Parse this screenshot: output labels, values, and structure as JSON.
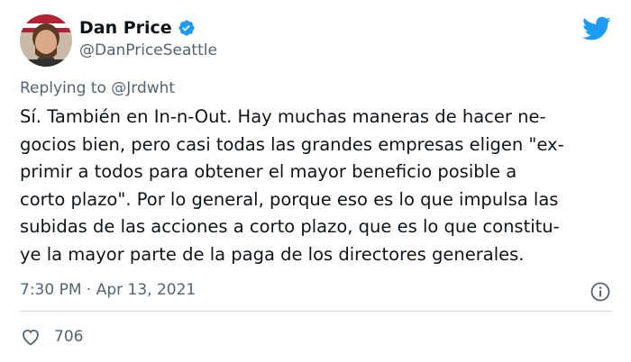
{
  "author": {
    "display_name": "Dan Price",
    "handle": "@DanPriceSeattle",
    "verified": true
  },
  "reply": {
    "prefix": "Replying to",
    "mention": "@Jrdwht"
  },
  "body_lines": [
    "Sí. También en In-n-Out. Hay muchas maneras de hacer ne-",
    "gocios bien, pero casi todas las grandes empresas eligen \"ex-",
    "primir a todos para obtener el mayor beneficio posible a",
    "corto plazo\". Por lo general, porque eso es lo que impulsa las",
    "subidas de las acciones a corto plazo, que es lo que constitu-",
    "ye la mayor parte de la paga de los directores generales."
  ],
  "timestamp": "7:30 PM · Apr 13, 2021",
  "likes": "706",
  "colors": {
    "twitter_blue": "#1d9bf0",
    "secondary_text": "#536471",
    "divider": "#cfd9de"
  },
  "icons": {
    "platform": "twitter-bird-icon",
    "verified": "verified-badge-icon",
    "info": "info-icon",
    "like": "heart-icon"
  }
}
